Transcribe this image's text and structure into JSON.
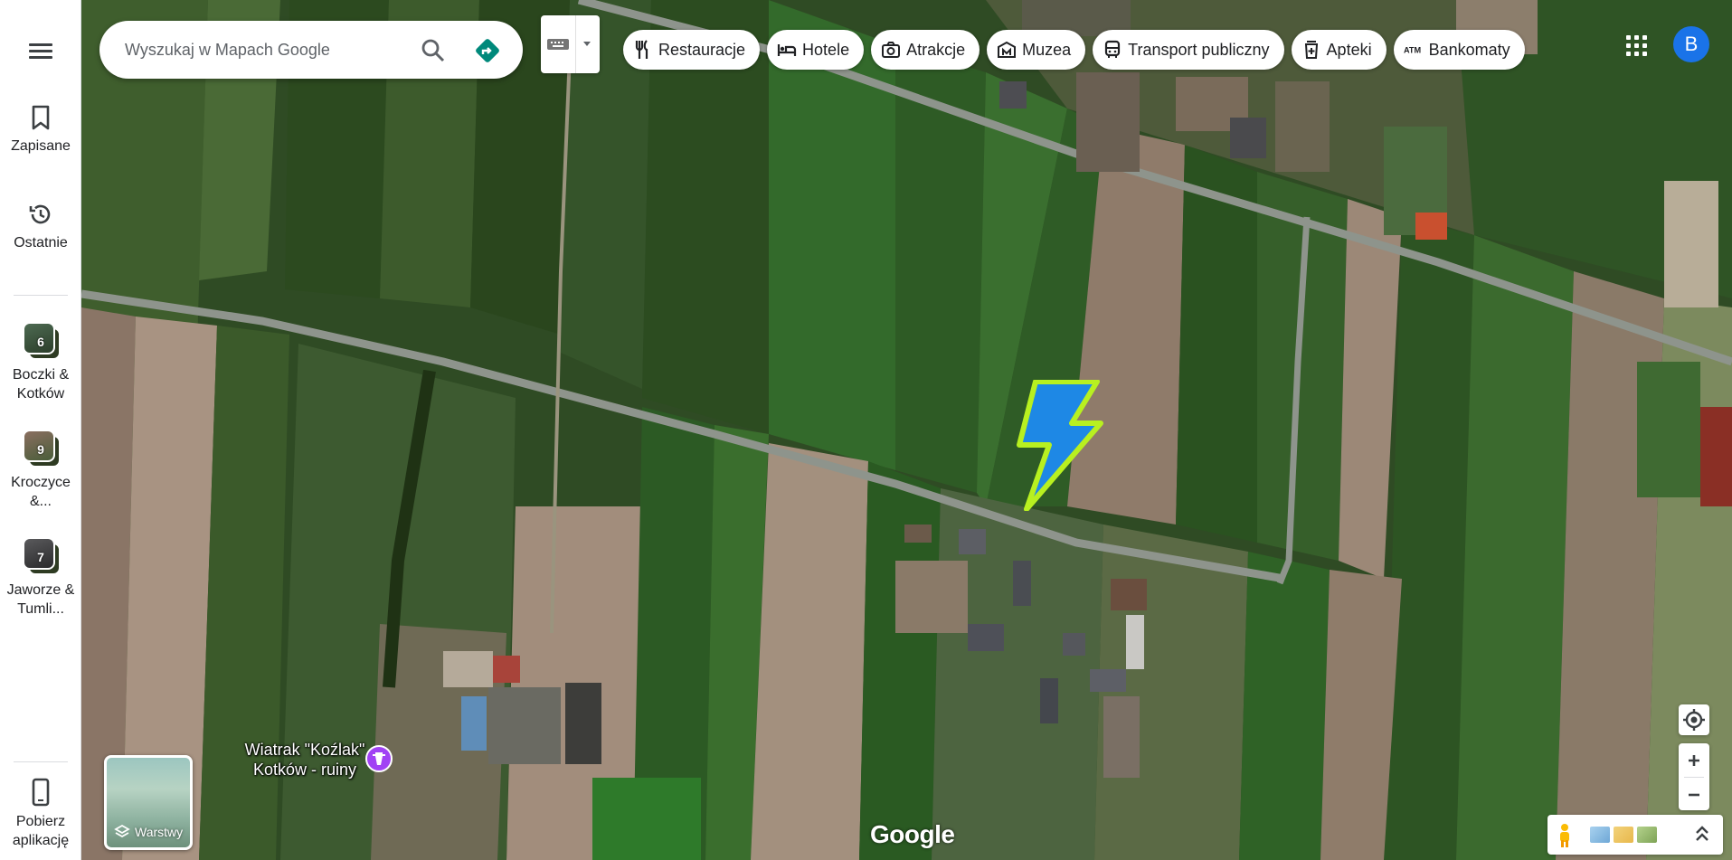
{
  "search": {
    "placeholder": "Wyszukaj w Mapach Google"
  },
  "sidebar": {
    "saved_label": "Zapisane",
    "recent_label": "Ostatnie",
    "trips": [
      {
        "count": "6",
        "label": "Boczki & Kotków"
      },
      {
        "count": "9",
        "label": "Kroczyce &..."
      },
      {
        "count": "7",
        "label": "Jaworze & Tumli..."
      }
    ],
    "get_app_label": "Pobierz aplikację"
  },
  "chips": [
    {
      "label": "Restauracje",
      "icon": "fork-knife-icon"
    },
    {
      "label": "Hotele",
      "icon": "bed-icon"
    },
    {
      "label": "Atrakcje",
      "icon": "camera-icon"
    },
    {
      "label": "Muzea",
      "icon": "museum-icon"
    },
    {
      "label": "Transport publiczny",
      "icon": "bus-icon"
    },
    {
      "label": "Apteki",
      "icon": "pharmacy-icon"
    },
    {
      "label": "Bankomaty",
      "icon": "atm-icon"
    }
  ],
  "account": {
    "initial": "B",
    "color": "#1a73e8"
  },
  "layers": {
    "label": "Warstwy"
  },
  "map": {
    "poi_label": "Wiatrak \"Koźlak\" Kotków - ruiny",
    "logo": "Google",
    "accent_bolt": "#b8f020"
  }
}
